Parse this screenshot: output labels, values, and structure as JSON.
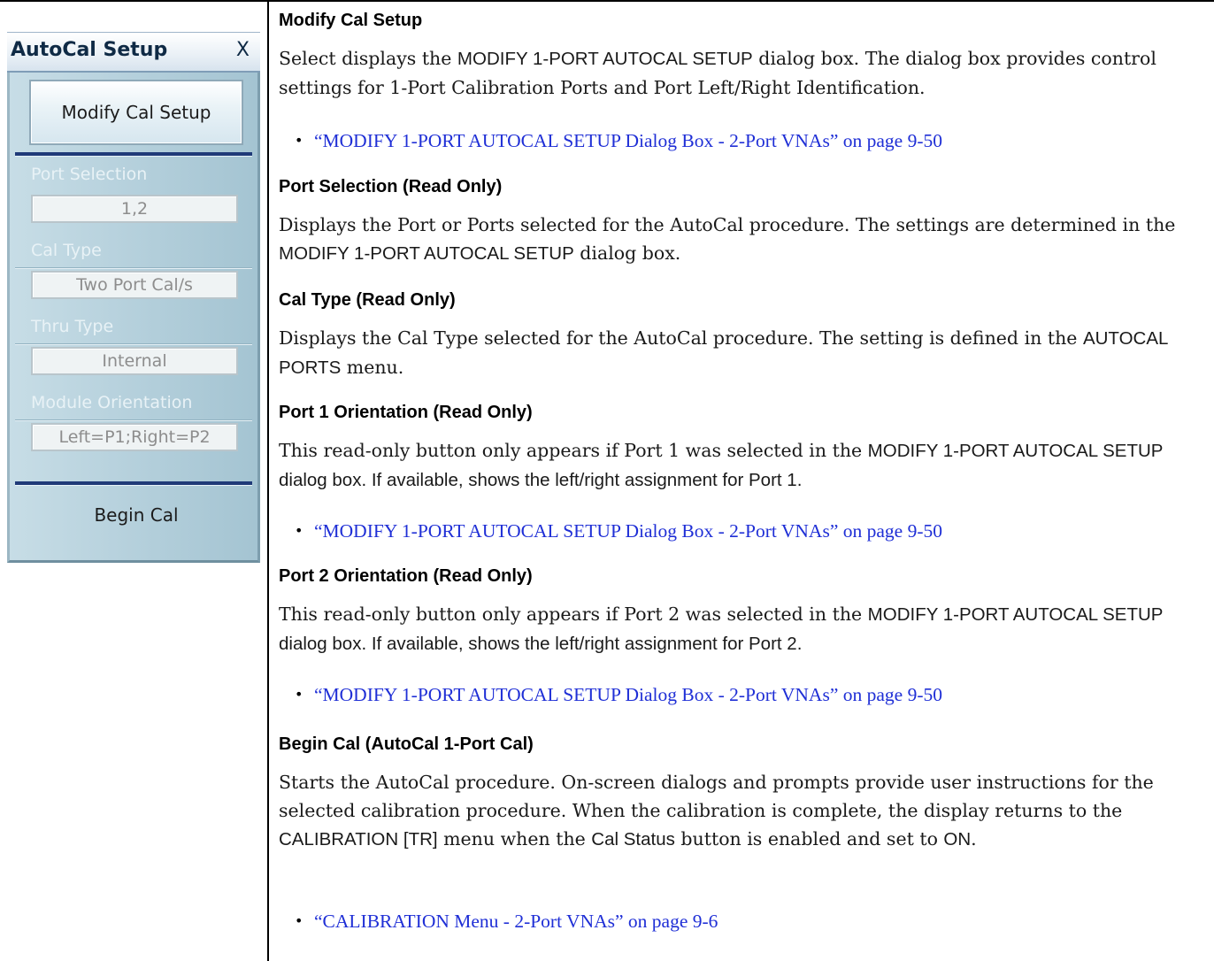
{
  "menu": {
    "title": "AutoCal Setup",
    "close_label": "X",
    "modify_button": "Modify Cal Setup",
    "fields": {
      "port_selection": {
        "label": "Port Selection",
        "value": "1,2"
      },
      "cal_type": {
        "label": "Cal Type",
        "value": "Two Port Cal/s"
      },
      "thru_type": {
        "label": "Thru Type",
        "value": "Internal"
      },
      "module_orientation": {
        "label": "Module Orientation",
        "value": "Left=P1;Right=P2"
      }
    },
    "begin_button": "Begin Cal"
  },
  "doc": {
    "s1": {
      "heading": "Modify Cal Setup",
      "p1": "Select displays the ",
      "p2": "MODIFY 1-PORT AUTOCAL SETUP",
      "p3": " dialog box. The dialog box provides control settings for 1-Port Calibration Ports and Port Left/Right Identification.",
      "link": "“MODIFY 1-PORT AUTOCAL SETUP Dialog Box - 2-Port VNAs” on page 9-50"
    },
    "s2": {
      "heading": "Port Selection (Read Only)",
      "p1": "Displays the Port or Ports selected for the AutoCal procedure. The settings are determined in the ",
      "p2": "MODIFY 1-PORT AUTOCAL SETUP",
      "p3": " dialog box."
    },
    "s3": {
      "heading": "Cal Type (Read Only)",
      "p1": "Displays the Cal Type selected for the AutoCal procedure. The setting is defined in the ",
      "p2": "AUTOCAL PORTS",
      "p3": " menu."
    },
    "s4": {
      "heading": "Port 1 Orientation (Read Only)",
      "p1": "This read-only button only appears if Port 1 was selected in the ",
      "p2": "MODIFY 1-PORT AUTOCAL SETUP",
      "p3": " dialog box. If available, shows the left/right assignment for Port 1.",
      "link": "“MODIFY 1-PORT AUTOCAL SETUP Dialog Box - 2-Port VNAs” on page 9-50"
    },
    "s5": {
      "heading": "Port 2 Orientation (Read Only)",
      "p1": "This read-only button only appears if Port 2 was selected in the ",
      "p2": "MODIFY 1-PORT AUTOCAL SETUP",
      "p3": " dialog box. If available, shows the left/right assignment for Port 2.",
      "link": "“MODIFY 1-PORT AUTOCAL SETUP Dialog Box - 2-Port VNAs” on page 9-50"
    },
    "s6": {
      "heading": "Begin Cal (AutoCal 1-Port Cal)",
      "p1": "Starts the AutoCal procedure. On-screen dialogs and prompts provide user instructions for the selected calibration procedure. When the calibration is complete, the display returns to the ",
      "p2": "CALIBRATION [TR]",
      "p3": " menu when the ",
      "p4": "Cal Status",
      "p5": " button is enabled and set to ",
      "p6": "ON",
      "p7": ".",
      "link": "“CALIBRATION Menu - 2-Port VNAs” on page 9-6"
    }
  }
}
